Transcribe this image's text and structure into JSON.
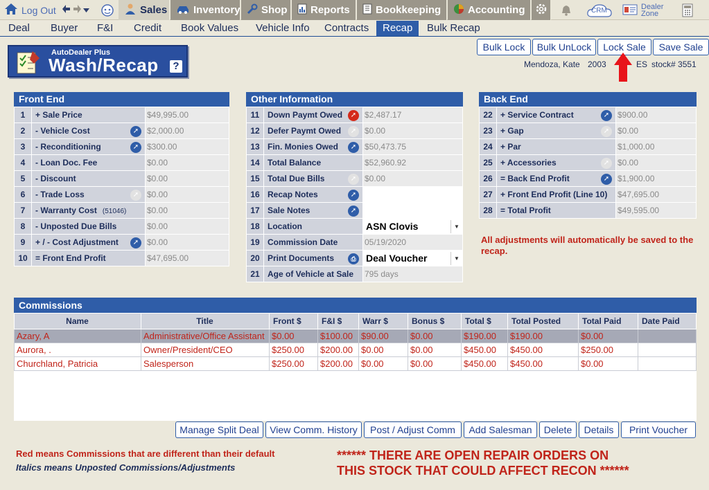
{
  "topnav": {
    "logout": "Log Out",
    "modules": [
      {
        "label": "Sales",
        "icon": "salesperson-icon"
      },
      {
        "label": "Inventory",
        "icon": "car-icon"
      },
      {
        "label": "Shop",
        "icon": "wrench-icon"
      },
      {
        "label": "Reports",
        "icon": "report-icon"
      },
      {
        "label": "Bookkeeping",
        "icon": "book-icon"
      },
      {
        "label": "Accounting",
        "icon": "pie-chart-icon"
      }
    ],
    "crm": "CRM",
    "dealer_zone_1": "Dealer",
    "dealer_zone_2": "Zone"
  },
  "subnav": {
    "items": [
      "Deal",
      "Buyer",
      "F&I",
      "Credit",
      "Book Values",
      "Vehicle Info",
      "Contracts",
      "Recap",
      "Bulk Recap"
    ],
    "active": "Recap"
  },
  "logo": {
    "small": "AutoDealer Plus",
    "big": "Wash/Recap",
    "help": "?"
  },
  "actions": {
    "bulk_lock": "Bulk Lock",
    "bulk_unlock": "Bulk UnLock",
    "lock_sale": "Lock Sale",
    "save_sale": "Save Sale"
  },
  "deal": {
    "customer": "Mendoza,  Kate",
    "year": "2003",
    "vehicle_partial": "ES",
    "stock": "stock# 3551"
  },
  "front_end": {
    "title": "Front End",
    "rows": [
      {
        "num": "1",
        "label": "+ Sale Price",
        "value": "$49,995.00"
      },
      {
        "num": "2",
        "label": "-  Vehicle Cost",
        "value": "$2,000.00"
      },
      {
        "num": "3",
        "label": "-  Reconditioning",
        "value": "$300.00"
      },
      {
        "num": "4",
        "label": "-  Loan Doc. Fee",
        "value": "$0.00"
      },
      {
        "num": "5",
        "label": "-  Discount",
        "value": "$0.00"
      },
      {
        "num": "6",
        "label": "-  Trade Loss",
        "value": "$0.00"
      },
      {
        "num": "7",
        "label": "-  Warranty Cost",
        "note": "(51046)",
        "value": "$0.00"
      },
      {
        "num": "8",
        "label": "-  Unposted Due Bills",
        "value": "$0.00"
      },
      {
        "num": "9",
        "label": "+ / -  Cost Adjustment",
        "value": "$0.00"
      },
      {
        "num": "10",
        "label": "= Front End Profit",
        "value": "$47,695.00"
      }
    ]
  },
  "other_info": {
    "title": "Other Information",
    "rows": [
      {
        "num": "11",
        "label": "Down Paymt Owed",
        "value": "$2,487.17"
      },
      {
        "num": "12",
        "label": "Defer Paymt Owed",
        "value": "$0.00"
      },
      {
        "num": "13",
        "label": "Fin. Monies Owed",
        "value": "$50,473.75"
      },
      {
        "num": "14",
        "label": "Total Balance",
        "value": "$52,960.92"
      },
      {
        "num": "15",
        "label": "Total Due Bills",
        "value": "$0.00"
      },
      {
        "num": "16",
        "label": "Recap Notes",
        "value": ""
      },
      {
        "num": "17",
        "label": "Sale Notes",
        "value": ""
      },
      {
        "num": "18",
        "label": "Location",
        "value": "ASN Clovis"
      },
      {
        "num": "19",
        "label": "Commission Date",
        "value": "05/19/2020"
      },
      {
        "num": "20",
        "label": "Print Documents",
        "value": "Deal Voucher"
      },
      {
        "num": "21",
        "label": "Age of Vehicle at Sale",
        "value": "795 days"
      }
    ]
  },
  "back_end": {
    "title": "Back End",
    "rows": [
      {
        "num": "22",
        "label": "+ Service Contract",
        "value": "$900.00"
      },
      {
        "num": "23",
        "label": "+ Gap",
        "value": "$0.00"
      },
      {
        "num": "24",
        "label": "+ Par",
        "value": "$1,000.00"
      },
      {
        "num": "25",
        "label": "+ Accessories",
        "value": "$0.00"
      },
      {
        "num": "26",
        "label": "= Back End Profit",
        "value": "$1,900.00"
      },
      {
        "num": "27",
        "label": "+ Front End Profit (Line 10)",
        "value": "$47,695.00"
      },
      {
        "num": "28",
        "label": "= Total Profit",
        "value": "$49,595.00"
      }
    ]
  },
  "adjust_note": "All adjustments will automatically be saved to the recap.",
  "commissions": {
    "title": "Commissions",
    "headers": [
      "Name",
      "Title",
      "Front $",
      "F&I $",
      "Warr $",
      "Bonus $",
      "Total $",
      "Total Posted",
      "Total Paid",
      "Date Paid"
    ],
    "rows": [
      [
        "Azary, A",
        "Administrative/Office Assistant",
        "$0.00",
        "$100.00",
        "$90.00",
        "$0.00",
        "$190.00",
        "$190.00",
        "$0.00",
        ""
      ],
      [
        "Aurora, .",
        "Owner/President/CEO",
        "$250.00",
        "$200.00",
        "$0.00",
        "$0.00",
        "$450.00",
        "$450.00",
        "$250.00",
        ""
      ],
      [
        "Churchland, Patricia",
        "Salesperson",
        "$250.00",
        "$200.00",
        "$0.00",
        "$0.00",
        "$450.00",
        "$450.00",
        "$0.00",
        ""
      ]
    ]
  },
  "comm_buttons": {
    "manage_split": "Manage Split Deal",
    "view_history": "View Comm. History",
    "post_adjust": "Post / Adjust Comm",
    "add_salesman": "Add Salesman",
    "delete": "Delete",
    "details": "Details",
    "print_voucher": "Print Voucher"
  },
  "legend": {
    "red": "Red means Commissions that are different than their default",
    "italic": "Italics means Unposted Commissions/Adjustments"
  },
  "warning": {
    "line1": "****** THERE ARE OPEN REPAIR ORDERS ON",
    "line2": "THIS STOCK THAT COULD AFFECT RECON ******"
  },
  "colors": {
    "primary": "#2f5da8",
    "background": "#ebe8db",
    "alert": "#c0241a",
    "active_tab": "#d4d1c3"
  }
}
